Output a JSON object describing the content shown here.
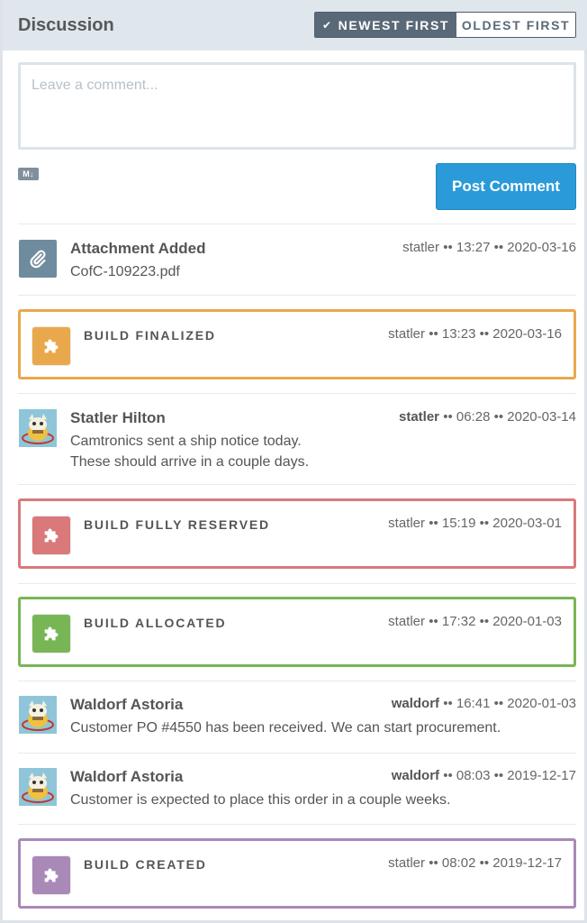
{
  "header": {
    "title": "Discussion",
    "sort_newest": "NEWEST FIRST",
    "sort_oldest": "OLDEST FIRST",
    "check": "✔"
  },
  "composer": {
    "placeholder": "Leave a comment...",
    "markdown_badge": "M↓",
    "post_label": "Post Comment"
  },
  "sep": "••",
  "colors": {
    "finalized": "#e9a84b",
    "reserved": "#d9797a",
    "allocated": "#78b655",
    "created": "#a889b8",
    "attachment": "#6f8b9e",
    "primary": "#2b9ad8"
  },
  "feed": [
    {
      "kind": "attachment",
      "title": "Attachment Added",
      "body": "CofC-109223.pdf",
      "user": "statler",
      "time": "13:27",
      "date": "2020-03-16",
      "icon": "paperclip-icon"
    },
    {
      "kind": "event",
      "label": "BUILD FINALIZED",
      "user": "statler",
      "time": "13:23",
      "date": "2020-03-16",
      "color": "finalized",
      "icon": "puzzle-icon"
    },
    {
      "kind": "comment",
      "author": "Statler Hilton",
      "body_lines": [
        "Camtronics sent a ship notice today.",
        "These should arrive in a couple days."
      ],
      "user": "statler",
      "time": "06:28",
      "date": "2020-03-14",
      "icon": "avatar"
    },
    {
      "kind": "event",
      "label": "BUILD FULLY RESERVED",
      "user": "statler",
      "time": "15:19",
      "date": "2020-03-01",
      "color": "reserved",
      "icon": "puzzle-icon"
    },
    {
      "kind": "event",
      "label": "BUILD ALLOCATED",
      "user": "statler",
      "time": "17:32",
      "date": "2020-01-03",
      "color": "allocated",
      "icon": "puzzle-icon"
    },
    {
      "kind": "comment",
      "author": "Waldorf Astoria",
      "body_lines": [
        "Customer PO #4550 has been received. We can start procurement."
      ],
      "user": "waldorf",
      "time": "16:41",
      "date": "2020-01-03",
      "icon": "avatar"
    },
    {
      "kind": "comment",
      "author": "Waldorf Astoria",
      "body_lines": [
        "Customer is expected to place this order in a couple weeks."
      ],
      "user": "waldorf",
      "time": "08:03",
      "date": "2019-12-17",
      "icon": "avatar"
    },
    {
      "kind": "event",
      "label": "BUILD CREATED",
      "user": "statler",
      "time": "08:02",
      "date": "2019-12-17",
      "color": "created",
      "icon": "puzzle-icon"
    }
  ]
}
